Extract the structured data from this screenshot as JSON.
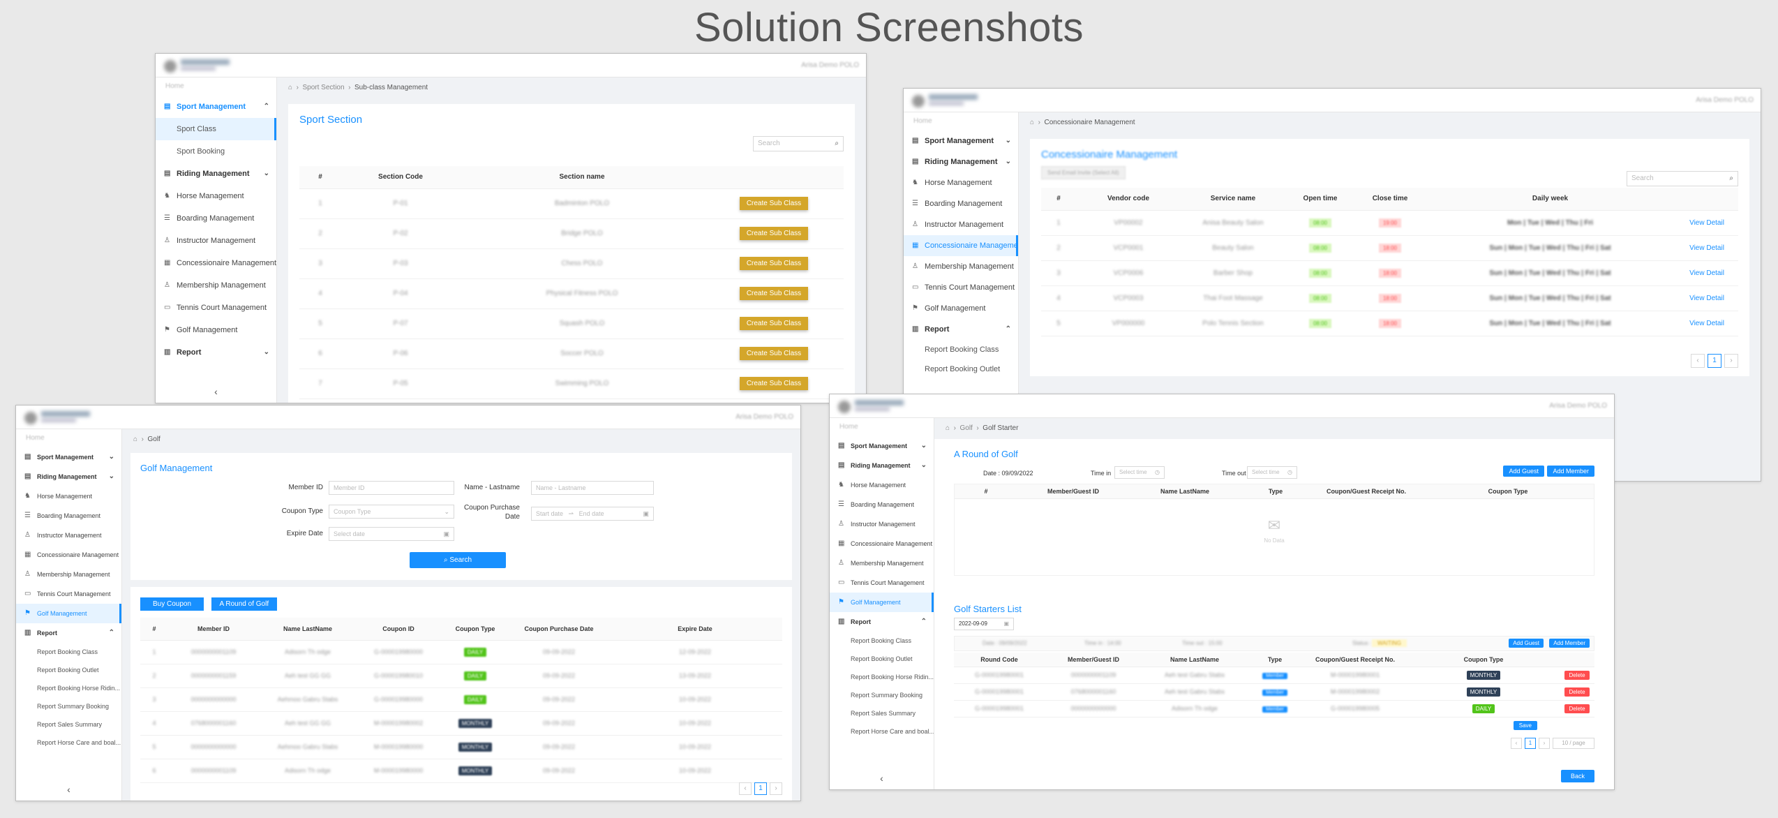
{
  "title": "Solution Screenshots",
  "colors": {
    "primary": "#1890ff",
    "gold": "#d4a62a",
    "danger": "#ff4d4f",
    "navy": "#2f4158",
    "success": "#52c41a"
  },
  "common": {
    "user": "Arisa Demo POLO",
    "home": "Home",
    "collapse": "‹",
    "search_placeholder": "Search"
  },
  "nav": {
    "sport_management": "Sport Management",
    "sport_class": "Sport Class",
    "sport_booking": "Sport Booking",
    "riding_management": "Riding Management",
    "horse_management": "Horse Management",
    "boarding_management": "Boarding Management",
    "instructor_management": "Instructor Management",
    "concessionaire_management": "Concessionaire Management",
    "membership_management": "Membership Management",
    "tennis_court_management": "Tennis Court Management",
    "golf_management": "Golf Management",
    "report": "Report",
    "report_booking_class": "Report Booking Class",
    "report_booking_outlet": "Report Booking Outlet",
    "report_booking_horse": "Report Booking Horse Ridin...",
    "report_summary_booking": "Report Summary Booking",
    "report_sales_summary": "Report Sales Summary",
    "report_horse_care": "Report Horse Care and boal..."
  },
  "sport": {
    "crumb1": "Sport Section",
    "crumb2": "Sub-class Management",
    "card_title": "Sport Section",
    "columns": [
      "#",
      "Section Code",
      "Section name"
    ],
    "rows": [
      {
        "n": "1",
        "code": "P-01",
        "name": "Badminton POLO"
      },
      {
        "n": "2",
        "code": "P-02",
        "name": "Bridge POLO"
      },
      {
        "n": "3",
        "code": "P-03",
        "name": "Chess POLO"
      },
      {
        "n": "4",
        "code": "P-04",
        "name": "Physical Fitness POLO"
      },
      {
        "n": "5",
        "code": "P-07",
        "name": "Squash POLO"
      },
      {
        "n": "6",
        "code": "P-06",
        "name": "Soccer POLO"
      },
      {
        "n": "7",
        "code": "P-05",
        "name": "Swimming POLO"
      }
    ],
    "action": "Create Sub Class"
  },
  "conc": {
    "crumb": "Concessionaire Management",
    "card_title": "Concessionaire Management",
    "top_btn": "Send Email Invite (Select All)",
    "columns": [
      "#",
      "Vendor code",
      "Service name",
      "Open time",
      "Close time",
      "Daily week"
    ],
    "rows": [
      {
        "n": "1",
        "code": "VP00002",
        "service": "Anisa Beauty Salon",
        "open": "08:00",
        "close": "19:00",
        "days": "Mon | Tue | Wed | Thu | Fri"
      },
      {
        "n": "2",
        "code": "VCP0001",
        "service": "Beauty Salon",
        "open": "08:00",
        "close": "18:00",
        "days": "Sun | Mon | Tue | Wed | Thu | Fri | Sat"
      },
      {
        "n": "3",
        "code": "VCP0006",
        "service": "Barber Shop",
        "open": "08:00",
        "close": "18:00",
        "days": "Sun | Mon | Tue | Wed | Thu | Fri | Sat"
      },
      {
        "n": "4",
        "code": "VCP0003",
        "service": "Thai Foot Massage",
        "open": "08:00",
        "close": "18:00",
        "days": "Sun | Mon | Tue | Wed | Thu | Fri | Sat"
      },
      {
        "n": "5",
        "code": "VP000000",
        "service": "Polo Tennis Section",
        "open": "08:00",
        "close": "18:00",
        "days": "Sun | Mon | Tue | Wed | Thu | Fri | Sat"
      }
    ],
    "action": "View Detail",
    "page": "1"
  },
  "golf": {
    "crumb": "Golf",
    "card_title": "Golf Management",
    "member_id_label": "Member ID",
    "member_id_ph": "Member ID",
    "name_label": "Name - Lastname",
    "name_ph": "Name - Lastname",
    "coupon_type_label": "Coupon Type",
    "coupon_type_ph": "Coupon Type",
    "purchase_label": "Coupon Purchase Date",
    "start_ph": "Start date",
    "end_ph": "End date",
    "expire_label": "Expire Date",
    "select_date_ph": "Select date",
    "search_btn": "Search",
    "buy_btn": "Buy Coupon",
    "round_btn": "A Round of Golf",
    "columns": [
      "#",
      "Member ID",
      "Name LastName",
      "Coupon ID",
      "Coupon Type",
      "Coupon Purchase Date",
      "Expire Date"
    ],
    "rows": [
      {
        "n": "1",
        "member": "0000000001109",
        "name": "Adisorn Th odge",
        "coupon": "G-000019980000",
        "type": "DAILY",
        "buy": "09-09-2022",
        "exp": "12-09-2022"
      },
      {
        "n": "2",
        "member": "0000000001159",
        "name": "Aeh test GG GG",
        "coupon": "G-000019980010",
        "type": "DAILY",
        "buy": "09-09-2022",
        "exp": "13-09-2022"
      },
      {
        "n": "3",
        "member": "0000000000000",
        "name": "Aehmoo Gabru Stabs",
        "coupon": "G-000019980000",
        "type": "DAILY",
        "buy": "09-09-2022",
        "exp": "10-09-2022"
      },
      {
        "n": "4",
        "member": "0768000001160",
        "name": "Aeh test GG GG",
        "coupon": "M-000019980002",
        "type": "MONTHLY",
        "buy": "09-09-2022",
        "exp": "10-09-2022"
      },
      {
        "n": "5",
        "member": "0000000000000",
        "name": "Aehmoo Gabru Stabs",
        "coupon": "M-000019980000",
        "type": "MONTHLY",
        "buy": "09-09-2022",
        "exp": "10-09-2022"
      },
      {
        "n": "6",
        "member": "0000000001109",
        "name": "Adisorn Th odge",
        "coupon": "M-000019980000",
        "type": "MONTHLY",
        "buy": "09-09-2022",
        "exp": "10-09-2022"
      }
    ],
    "page": "1"
  },
  "starter": {
    "crumb1": "Golf",
    "crumb2": "Golf Starter",
    "round_title": "A Round of Golf",
    "date_text": "Date : 09/09/2022",
    "time_in_label": "Time in",
    "time_out_label": "Time out",
    "select_time_ph": "Select time",
    "add_guest": "Add Guest",
    "add_member": "Add Member",
    "round_columns": [
      "#",
      "Member/Guest ID",
      "Name LastName",
      "Type",
      "Coupon/Guest Receipt No.",
      "Coupon Type"
    ],
    "no_data": "No Data",
    "list_title": "Golf Starters List",
    "date_value": "2022-09-09",
    "summary_date": "Date : 09/09/2022",
    "summary_in": "Time in : 14:00",
    "summary_out": "Time out : 15:00",
    "summary_status": "Status :",
    "status_value": "WAITING",
    "list_columns": [
      "Round Code",
      "Member/Guest ID",
      "Name LastName",
      "Type",
      "Coupon/Guest Receipt No.",
      "Coupon Type"
    ],
    "list_rows": [
      {
        "round": "G-000019980001",
        "member": "0000000001109",
        "name": "Aeh test Gabru Stabs",
        "type": "Member",
        "receipt": "M-000019980001",
        "ctype": "MONTHLY"
      },
      {
        "round": "G-000019980001",
        "member": "0768000001160",
        "name": "Aeh test Gabru Stabs",
        "type": "Member",
        "receipt": "M-000019980002",
        "ctype": "MONTHLY"
      },
      {
        "round": "G-000019980001",
        "member": "0000000000000",
        "name": "Adisorn Th odge",
        "type": "Member",
        "receipt": "G-000019980005",
        "ctype": "DAILY"
      }
    ],
    "delete": "Delete",
    "save": "Save",
    "page": "1",
    "page_size": "10 / page",
    "back": "Back"
  }
}
